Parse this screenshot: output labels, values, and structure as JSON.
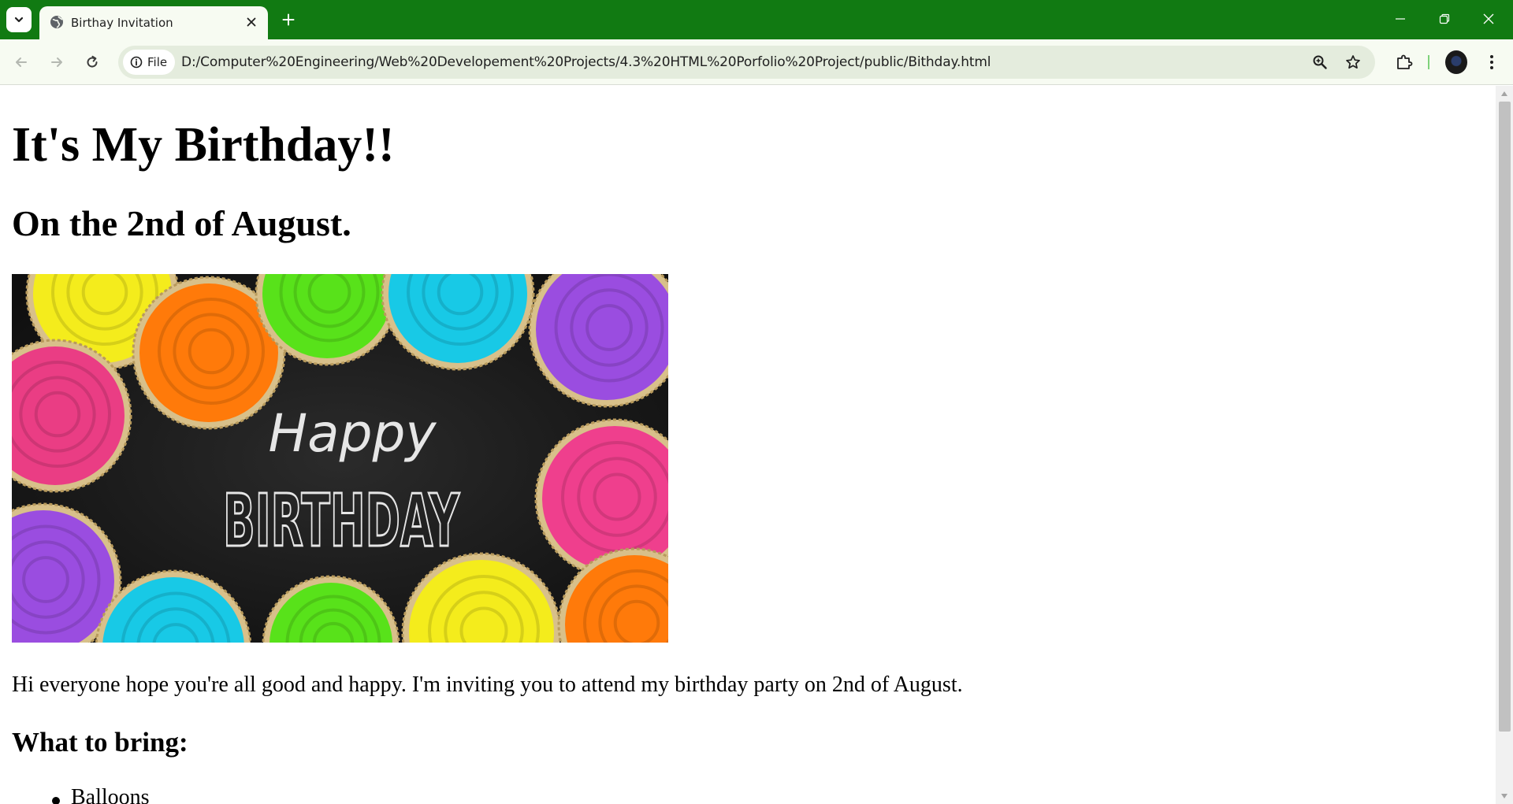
{
  "browser": {
    "tab": {
      "title": "Birthay Invitation"
    },
    "address_bar": {
      "site_chip_label": "File",
      "url": "D:/Computer%20Engineering/Web%20Developement%20Projects/4.3%20HTML%20Porfolio%20Project/public/Bithday.html"
    },
    "icons": {
      "tab_search": "chevron-down-icon",
      "favicon": "globe-icon",
      "close_tab": "close-icon",
      "new_tab": "plus-icon",
      "minimize": "minimize-icon",
      "restore": "restore-icon",
      "close_window": "close-icon",
      "back": "arrow-left-icon",
      "forward": "arrow-right-icon",
      "reload": "reload-icon",
      "site_info": "info-icon",
      "zoom": "zoom-icon",
      "bookmark": "star-icon",
      "extensions": "puzzle-icon",
      "menu": "kebab-menu-icon"
    },
    "colors": {
      "frame": "#117a12",
      "toolbar": "#f7fbf2",
      "omnibox": "#e4ecdd"
    }
  },
  "page": {
    "heading": "It's My Birthday!!",
    "subheading": "On the 2nd of August.",
    "banner": {
      "line1": "Happy",
      "line2": "BIRTHDAY"
    },
    "intro": "Hi everyone hope you're all good and happy. I'm inviting you to attend my birthday party on 2nd of August.",
    "bring_heading": "What to bring:",
    "bring_items": [
      "Balloons"
    ]
  }
}
